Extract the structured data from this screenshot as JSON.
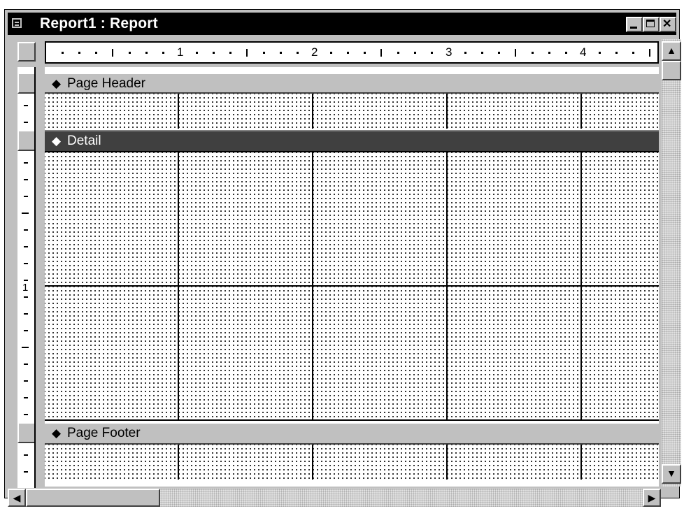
{
  "window": {
    "title": "Report1 : Report",
    "icons": [
      "system-menu-icon",
      "minimize-icon",
      "maximize-icon",
      "close-icon"
    ]
  },
  "ruler": {
    "horizontal_numbers": [
      "1",
      "2",
      "3",
      "4"
    ],
    "vertical_numbers": [
      "1"
    ]
  },
  "sections": {
    "page_header": "Page Header",
    "detail": "Detail",
    "page_footer": "Page Footer"
  },
  "scroll": {
    "up": "▲",
    "down": "▼",
    "left": "◀",
    "right": "▶"
  },
  "colors": {
    "titlebar": "#000000",
    "chrome": "#c0c0c0",
    "selected_section": "#404040"
  }
}
